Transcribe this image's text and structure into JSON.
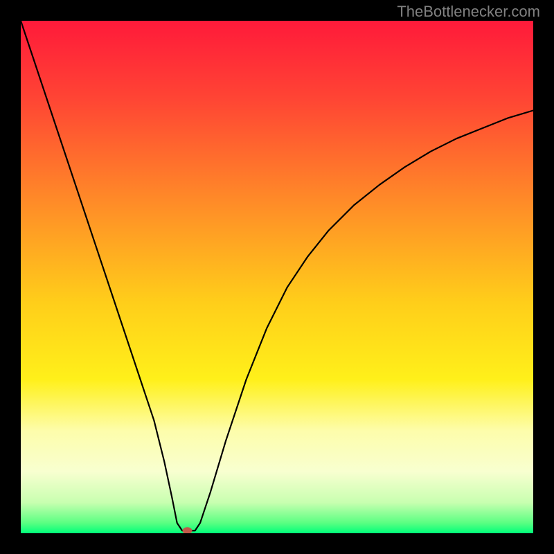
{
  "watermark": "TheBottlenecker.com",
  "chart_data": {
    "type": "line",
    "title": "",
    "xlabel": "",
    "ylabel": "",
    "xlim": [
      0,
      100
    ],
    "ylim": [
      0,
      100
    ],
    "background": {
      "type": "vertical-gradient",
      "stops": [
        {
          "offset": 0,
          "color": "#ff1a3a"
        },
        {
          "offset": 15,
          "color": "#ff4434"
        },
        {
          "offset": 35,
          "color": "#ff8a28"
        },
        {
          "offset": 55,
          "color": "#ffce1a"
        },
        {
          "offset": 70,
          "color": "#fff01a"
        },
        {
          "offset": 80,
          "color": "#fdfdab"
        },
        {
          "offset": 88,
          "color": "#f8ffd0"
        },
        {
          "offset": 94,
          "color": "#c8ffb0"
        },
        {
          "offset": 98,
          "color": "#5aff82"
        },
        {
          "offset": 100,
          "color": "#00ff7a"
        }
      ]
    },
    "series": [
      {
        "name": "bottleneck-curve",
        "color": "#000000",
        "x": [
          0,
          2,
          5,
          8,
          11,
          14,
          17,
          20,
          23,
          26,
          28,
          29.5,
          30.5,
          31.5,
          33,
          34,
          35,
          37,
          40,
          44,
          48,
          52,
          56,
          60,
          65,
          70,
          75,
          80,
          85,
          90,
          95,
          100
        ],
        "y": [
          100,
          94,
          85,
          76,
          67,
          58,
          49,
          40,
          31,
          22,
          14,
          7,
          2,
          0.5,
          0.5,
          0.5,
          2,
          8,
          18,
          30,
          40,
          48,
          54,
          59,
          64,
          68,
          71.5,
          74.5,
          77,
          79,
          81,
          82.5
        ]
      }
    ],
    "marker": {
      "name": "optimal-point",
      "x": 32.5,
      "y": 0.5,
      "color": "#c25a4a",
      "rx": 7,
      "ry": 5
    }
  }
}
